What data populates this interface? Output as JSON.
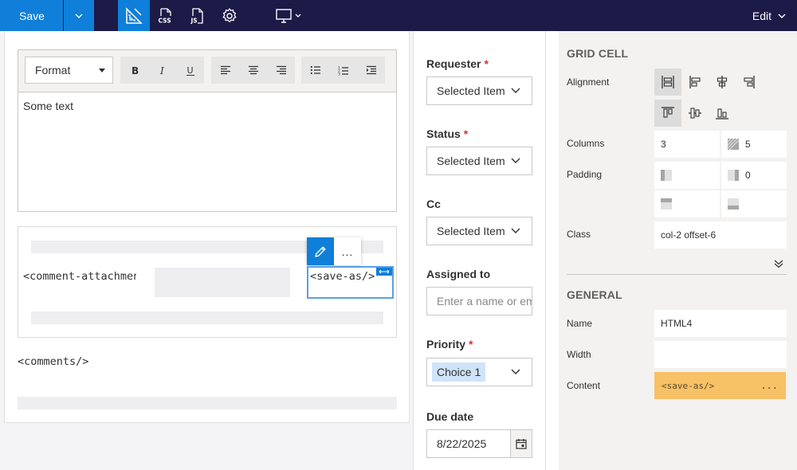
{
  "toolbar": {
    "save_label": "Save",
    "edit_label": "Edit"
  },
  "editor": {
    "format_label": "Format",
    "body_text": "Some text"
  },
  "grid": {
    "attachment_tag": "<comment-attachment/>",
    "selected_tag": "<save-as/>",
    "more_label": "...",
    "comments_tag": "<comments/>"
  },
  "fields": {
    "requester": {
      "label": "Requester",
      "required": "*",
      "value": "Selected Item"
    },
    "status": {
      "label": "Status",
      "required": "*",
      "value": "Selected Item"
    },
    "cc": {
      "label": "Cc",
      "value": "Selected Item"
    },
    "assigned_to": {
      "label": "Assigned to",
      "placeholder": "Enter a name or email"
    },
    "priority": {
      "label": "Priority",
      "required": "*",
      "value": "Choice 1"
    },
    "due_date": {
      "label": "Due date",
      "value": "8/22/2025"
    }
  },
  "properties": {
    "grid_cell": {
      "title": "GRID CELL",
      "alignment_label": "Alignment",
      "columns_label": "Columns",
      "columns_value": "3",
      "offset_value": "5",
      "padding_label": "Padding",
      "padding_right_value": "0",
      "class_label": "Class",
      "class_value": "col-2 offset-6"
    },
    "general": {
      "title": "GENERAL",
      "name_label": "Name",
      "name_value": "HTML4",
      "width_label": "Width",
      "width_value": "",
      "content_label": "Content",
      "content_value": "<save-as/>",
      "content_more": "..."
    }
  },
  "colors": {
    "topbar": "#1c1a47",
    "accent": "#0f7fd9",
    "content_highlight": "#f7c166",
    "required": "#d13438"
  },
  "icons": {
    "toolbar": [
      "layout-ruler-icon",
      "css-icon",
      "js-icon",
      "gear-icon",
      "monitor-icon"
    ],
    "editor": [
      "bold-icon",
      "italic-icon",
      "underline-icon",
      "align-left-icon",
      "align-center-icon",
      "align-right-icon",
      "bullet-list-icon",
      "numbered-list-icon",
      "indent-icon"
    ]
  }
}
